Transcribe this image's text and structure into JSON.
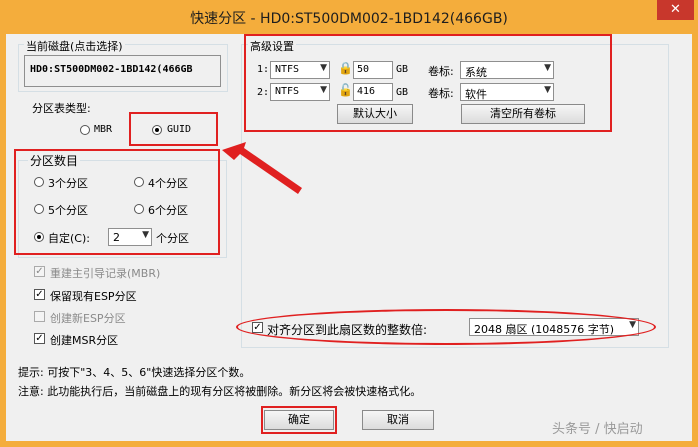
{
  "window": {
    "title": "快速分区 - HD0:ST500DM002-1BD142(466GB)",
    "close_glyph": "✕"
  },
  "disk": {
    "label": "当前磁盘(点击选择)",
    "value": "HD0:ST500DM002-1BD142(466GB"
  },
  "partition_table": {
    "label": "分区表类型:",
    "options": [
      "MBR",
      "GUID"
    ],
    "selected": "GUID"
  },
  "partition_count": {
    "label": "分区数目",
    "options": [
      "3个分区",
      "4个分区",
      "5个分区",
      "6个分区"
    ],
    "custom_label": "自定(C):",
    "custom_value": "2",
    "custom_suffix": "个分区",
    "selected": "custom"
  },
  "checkboxes": [
    {
      "label": "重建主引导记录(MBR)",
      "checked": true,
      "disabled": true
    },
    {
      "label": "保留现有ESP分区",
      "checked": true,
      "disabled": false
    },
    {
      "label": "创建新ESP分区",
      "checked": false,
      "disabled": true
    },
    {
      "label": "创建MSR分区",
      "checked": true,
      "disabled": false
    }
  ],
  "advanced": {
    "title": "高级设置",
    "rows": [
      {
        "index": "1:",
        "fs": "NTFS",
        "size": "50",
        "unit": "GB",
        "vol_label": "卷标:",
        "vol_value": "系统"
      },
      {
        "index": "2:",
        "fs": "NTFS",
        "size": "416",
        "unit": "GB",
        "vol_label": "卷标:",
        "vol_value": "软件"
      }
    ],
    "default_size_button": "默认大小",
    "clear_labels_button": "清空所有卷标"
  },
  "align": {
    "checked": true,
    "label": "对齐分区到此扇区数的整数倍:",
    "value": "2048 扇区 (1048576 字节)"
  },
  "hints": {
    "tip": "提示: 可按下\"3、4、5、6\"快速选择分区个数。",
    "note": "注意: 此功能执行后，当前磁盘上的现有分区将被删除。新分区将会被快速格式化。"
  },
  "buttons": {
    "ok": "确定",
    "cancel": "取消"
  },
  "watermark": "头条号 / 快启动",
  "colors": {
    "frame": "#f4ad3c",
    "annotation_red": "#e02020",
    "close": "#c8372c"
  }
}
